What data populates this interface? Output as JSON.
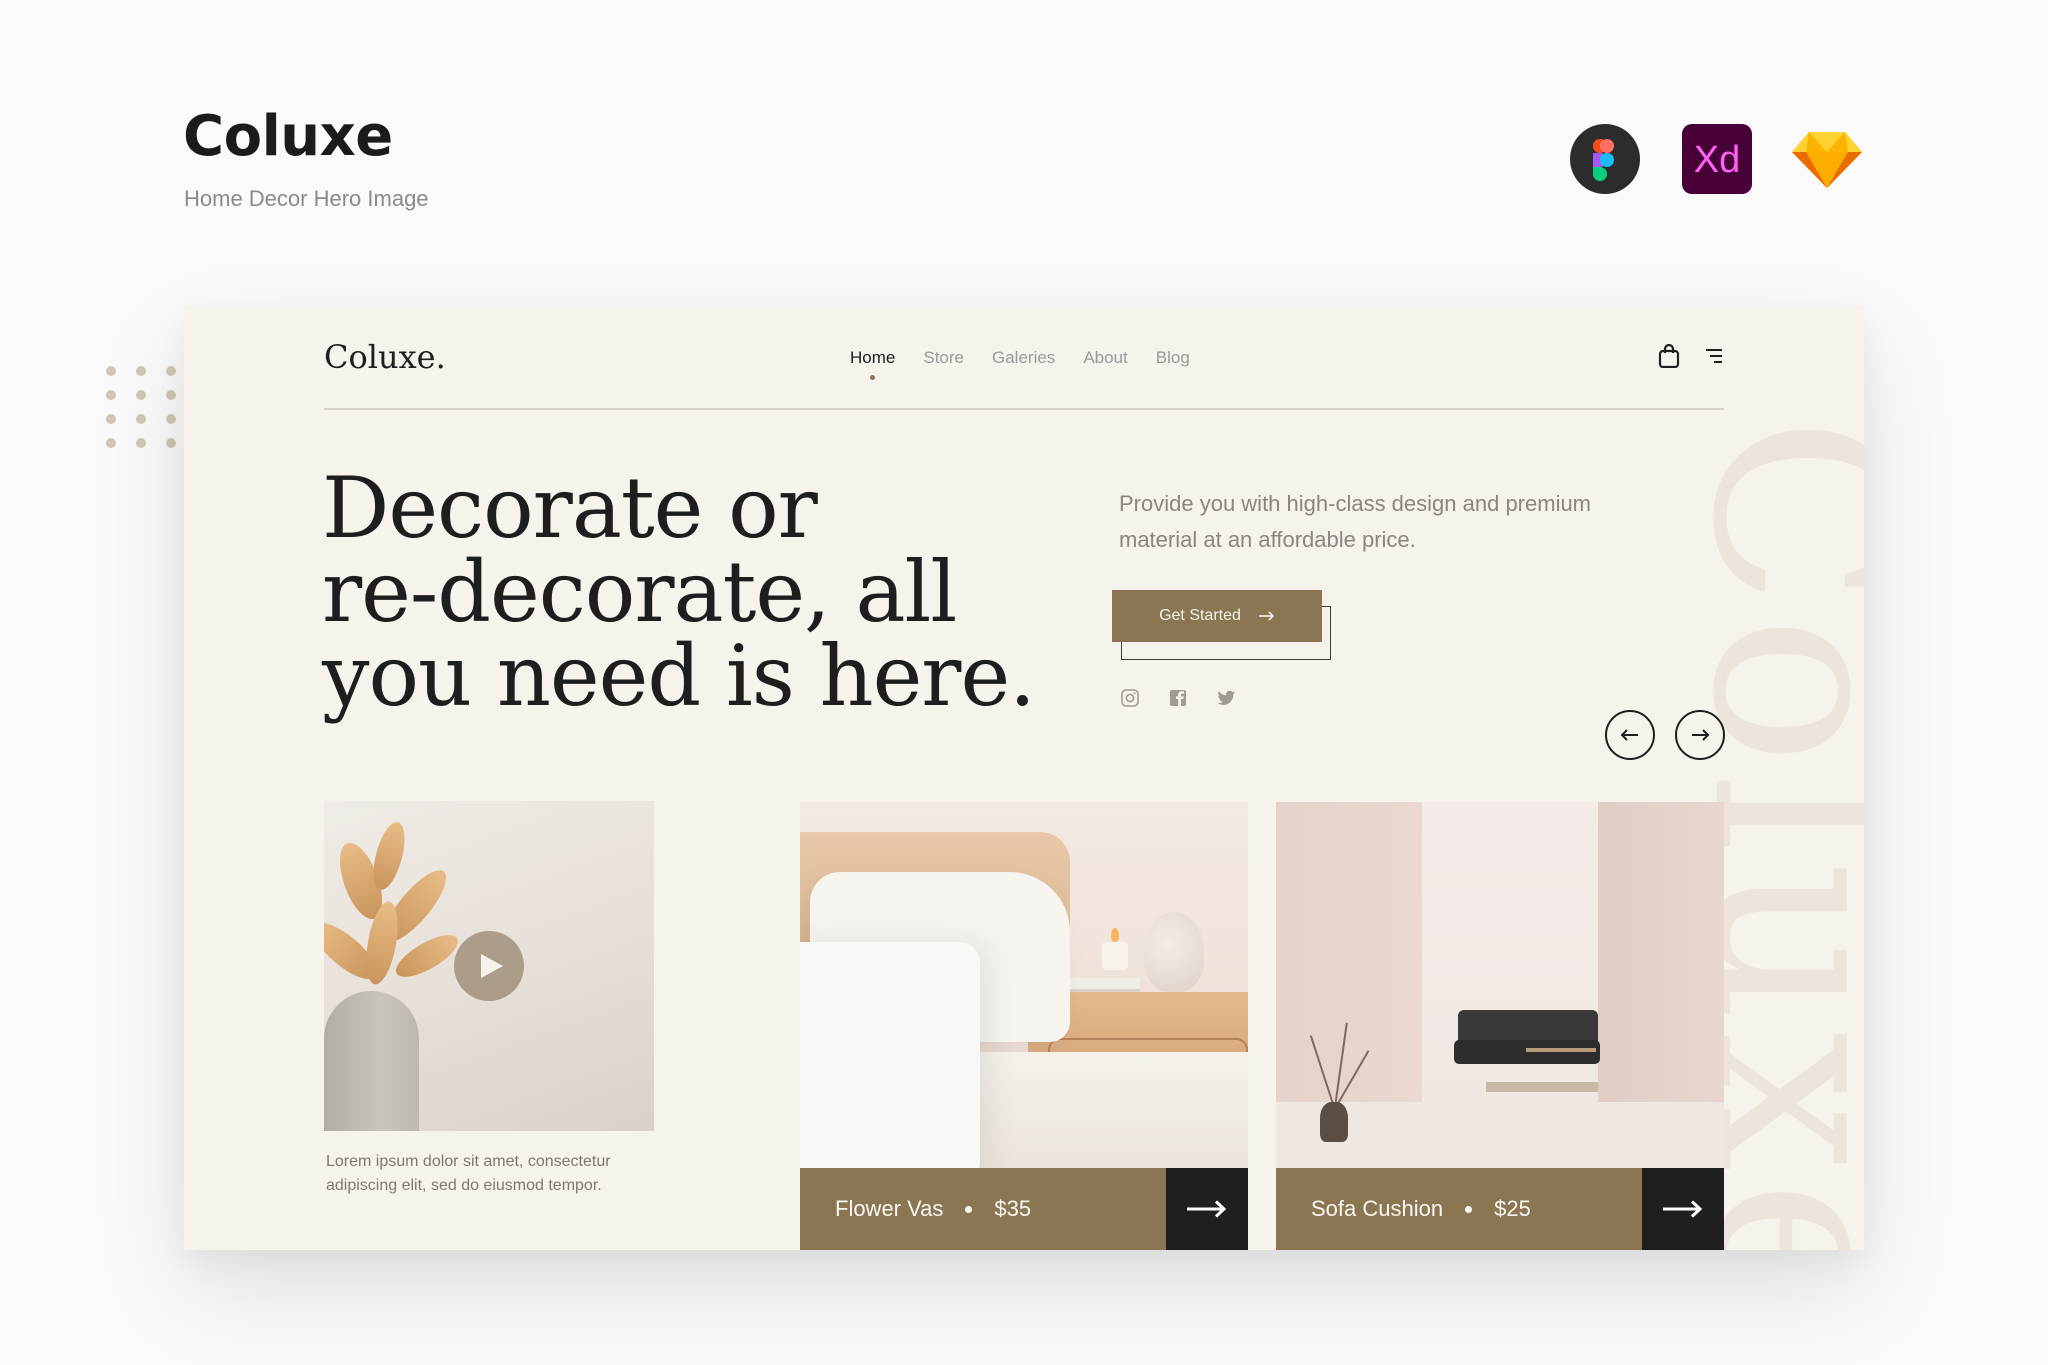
{
  "presentation": {
    "title": "Coluxe",
    "subtitle": "Home Decor Hero Image",
    "tools": [
      {
        "name": "figma-icon",
        "label": ""
      },
      {
        "name": "adobe-xd-icon",
        "label": "Xd"
      },
      {
        "name": "sketch-icon",
        "label": ""
      }
    ]
  },
  "site": {
    "logo": "Coluxe.",
    "nav": [
      {
        "label": "Home",
        "active": true
      },
      {
        "label": "Store",
        "active": false
      },
      {
        "label": "Galeries",
        "active": false
      },
      {
        "label": "About",
        "active": false
      },
      {
        "label": "Blog",
        "active": false
      }
    ],
    "background_word": "Coluxe"
  },
  "hero": {
    "headline_lines": [
      "Decorate or",
      "re-decorate, all",
      "you need is here."
    ],
    "tagline": "Provide you with high-class design and premium material at an affordable price.",
    "cta_label": "Get Started",
    "social": [
      "instagram-icon",
      "facebook-icon",
      "twitter-icon"
    ]
  },
  "video": {
    "caption": "Lorem ipsum dolor sit amet, consectetur adipiscing elit, sed do eiusmod tempor."
  },
  "products": [
    {
      "name": "Flower Vas",
      "price": "$35"
    },
    {
      "name": "Sofa Cushion",
      "price": "$25"
    }
  ],
  "colors": {
    "accent": "#8b7654",
    "card_bg": "#f6f2ec",
    "dark": "#1f1f1f",
    "page_bg": "#fafafa"
  }
}
